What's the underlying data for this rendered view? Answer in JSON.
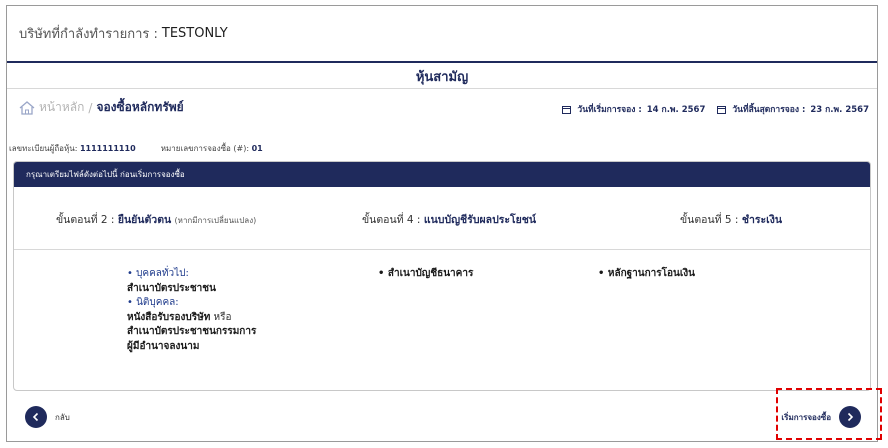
{
  "company": {
    "label": "บริษัทที่กำลังทำรายการ :",
    "name": "TESTONLY"
  },
  "section_title": "หุ้นสามัญ",
  "breadcrumb": {
    "home": "หน้าหลัก",
    "separator": "/",
    "current": "จองซื้อหลักทรัพย์"
  },
  "dates": {
    "start_label": "วันที่เริ่มการจอง :",
    "start_value": "14 ก.พ. 2567",
    "end_label": "วันที่สิ้นสุดการจอง :",
    "end_value": "23 ก.พ. 2567"
  },
  "holder": {
    "reg_label": "เลขทะเบียนผู้ถือหุ้น:",
    "reg_value": "1111111110",
    "sub_label": "หมายเลขการจองซื้อ (#):",
    "sub_value": "01"
  },
  "panel": {
    "header": "กรุณาเตรียมไฟล์ดังต่อไปนี้ ก่อนเริ่มการจองซื้อ",
    "steps": [
      {
        "prefix": "ขั้นตอนที่ 2 :",
        "title": "ยืนยันตัวตน",
        "note": "(หากมีการเปลี่ยนแปลง)"
      },
      {
        "prefix": "ขั้นตอนที่ 4 :",
        "title": "แนบบัญชีรับผลประโยชน์",
        "note": ""
      },
      {
        "prefix": "ขั้นตอนที่ 5 :",
        "title": "ชำระเงิน",
        "note": ""
      }
    ],
    "docs": {
      "col1": {
        "individual_label": "• บุคคลทั่วไป:",
        "individual_doc": "สำเนาบัตรประชาชน",
        "juristic_label": "• นิติบุคคล:",
        "juristic_doc_bold": "หนังสือรับรองบริษัท",
        "juristic_doc_or": " หรือ",
        "juristic_doc_line2": "สำเนาบัตรประชาชนกรรมการ",
        "juristic_doc_line3": "ผู้มีอำนาจลงนาม"
      },
      "col2": "• สำเนาบัญชีธนาคาร",
      "col3": "• หลักฐานการโอนเงิน"
    }
  },
  "footer": {
    "back_label": "กลับ",
    "next_label": "เริ่มการจองซื้อ"
  },
  "colors": {
    "navy": "#1f2a5c",
    "highlight": "#e00000"
  },
  "icons": [
    "home-icon",
    "calendar-icon",
    "chevron-left-icon",
    "chevron-right-icon"
  ]
}
